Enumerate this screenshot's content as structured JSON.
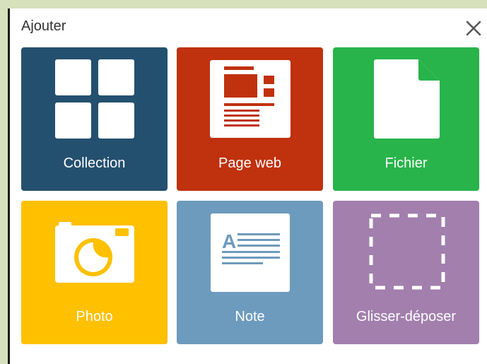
{
  "dialog": {
    "title": "Ajouter",
    "close_icon": "close-icon"
  },
  "tiles": [
    {
      "label": "Collection",
      "color": "#24506f",
      "icon": "grid-icon"
    },
    {
      "label": "Page web",
      "color": "#c0310e",
      "icon": "webpage-icon"
    },
    {
      "label": "Fichier",
      "color": "#28b44b",
      "icon": "file-icon"
    },
    {
      "label": "Photo",
      "color": "#ffc000",
      "icon": "camera-icon"
    },
    {
      "label": "Note",
      "color": "#6d9bbd",
      "icon": "note-icon"
    },
    {
      "label": "Glisser-déposer",
      "color": "#a27fad",
      "icon": "dropzone-icon"
    }
  ]
}
